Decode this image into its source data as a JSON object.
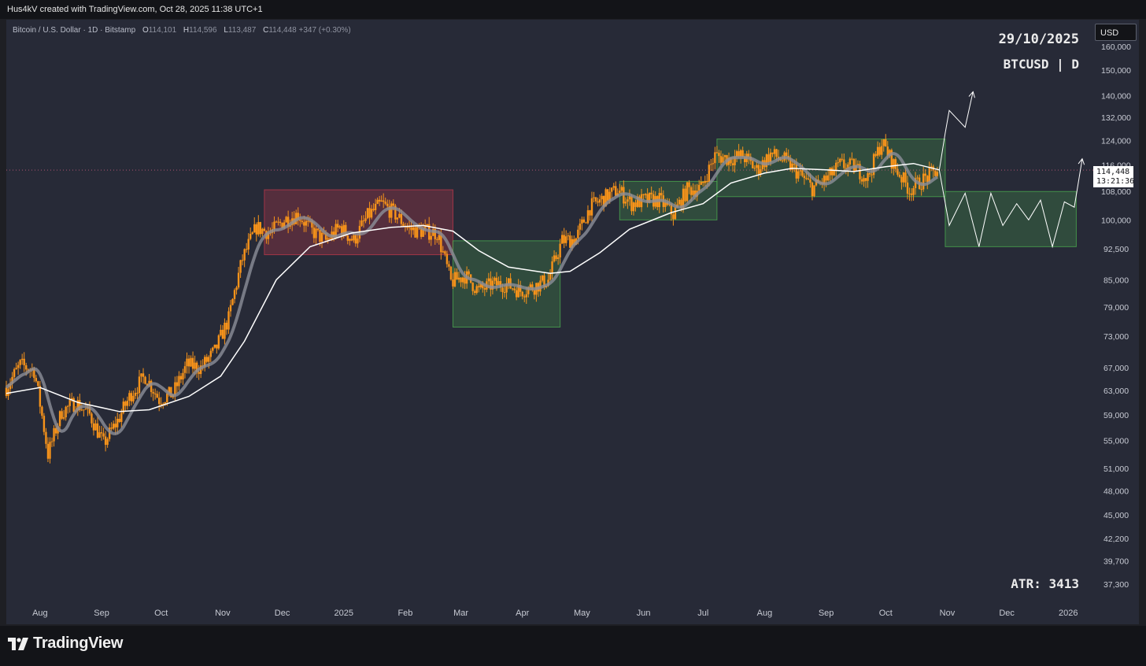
{
  "header": {
    "attribution": "Hus4kV created with TradingView.com, Oct 28, 2025 11:38 UTC+1"
  },
  "legend": {
    "symbol": "Bitcoin / U.S. Dollar · 1D · Bitstamp",
    "open_label": "O",
    "open": "114,101",
    "high_label": "H",
    "high": "114,596",
    "low_label": "L",
    "low": "113,487",
    "close_label": "C",
    "close": "114,448",
    "change": "+347 (+0.30%)"
  },
  "watermark": {
    "date": "29/10/2025",
    "symbol": "BTCUSD | D"
  },
  "indicator": {
    "atr": "ATR: 3413"
  },
  "price_scale": {
    "currency": "USD",
    "last_price": "114,448",
    "countdown": "13:21:36"
  },
  "footer": {
    "brand": "TradingView"
  },
  "colors": {
    "background": "#272a37",
    "candle": "#f7931a",
    "ma_fast": "#8c8f99",
    "ma_slow": "#ffffff",
    "range_red": "#c0394b",
    "range_green": "#4caf50",
    "projection": "#ffffff"
  },
  "chart_data": {
    "type": "line",
    "scale": "log",
    "ylim": [
      35500,
      172000
    ],
    "xlim": [
      "2024-07-15",
      "2026-01-10"
    ],
    "y_ticks": [
      160000,
      150000,
      140000,
      132000,
      124000,
      116000,
      108000,
      100000,
      92500,
      85000,
      79000,
      73000,
      67000,
      63000,
      59000,
      55000,
      51000,
      48000,
      45000,
      42200,
      39700,
      37300
    ],
    "y_tick_labels": [
      "160,000",
      "150,000",
      "140,000",
      "132,000",
      "124,000",
      "116,000",
      "108,000",
      "100,000",
      "92,500",
      "85,000",
      "79,000",
      "73,000",
      "67,000",
      "63,000",
      "59,000",
      "55,000",
      "51,000",
      "48,000",
      "45,000",
      "42,200",
      "39,700",
      "37,300"
    ],
    "x_ticks": [
      {
        "label": "Aug",
        "date": "2024-08-01"
      },
      {
        "label": "Sep",
        "date": "2024-09-01"
      },
      {
        "label": "Oct",
        "date": "2024-10-01"
      },
      {
        "label": "Nov",
        "date": "2024-11-01"
      },
      {
        "label": "Dec",
        "date": "2024-12-01"
      },
      {
        "label": "2025",
        "date": "2025-01-01"
      },
      {
        "label": "Feb",
        "date": "2025-02-01"
      },
      {
        "label": "Mar",
        "date": "2025-03-01"
      },
      {
        "label": "Apr",
        "date": "2025-04-01"
      },
      {
        "label": "May",
        "date": "2025-05-01"
      },
      {
        "label": "Jun",
        "date": "2025-06-01"
      },
      {
        "label": "Jul",
        "date": "2025-07-01"
      },
      {
        "label": "Aug",
        "date": "2025-08-01"
      },
      {
        "label": "Sep",
        "date": "2025-09-01"
      },
      {
        "label": "Oct",
        "date": "2025-10-01"
      },
      {
        "label": "Nov",
        "date": "2025-11-01"
      },
      {
        "label": "Dec",
        "date": "2025-12-01"
      },
      {
        "label": "2026",
        "date": "2026-01-01"
      }
    ],
    "last_price": 114448,
    "series": [
      {
        "name": "BTCUSD close",
        "style": "candles",
        "points": [
          [
            "2024-07-15",
            63500
          ],
          [
            "2024-07-22",
            67500
          ],
          [
            "2024-07-29",
            66500
          ],
          [
            "2024-08-05",
            53000
          ],
          [
            "2024-08-12",
            59500
          ],
          [
            "2024-08-19",
            61000
          ],
          [
            "2024-08-26",
            59000
          ],
          [
            "2024-09-02",
            54500
          ],
          [
            "2024-09-09",
            58000
          ],
          [
            "2024-09-16",
            62500
          ],
          [
            "2024-09-23",
            65500
          ],
          [
            "2024-09-30",
            61500
          ],
          [
            "2024-10-07",
            62500
          ],
          [
            "2024-10-14",
            67500
          ],
          [
            "2024-10-21",
            67000
          ],
          [
            "2024-10-28",
            70000
          ],
          [
            "2024-11-04",
            76500
          ],
          [
            "2024-11-11",
            90000
          ],
          [
            "2024-11-18",
            98000
          ],
          [
            "2024-11-25",
            96500
          ],
          [
            "2024-12-02",
            100000
          ],
          [
            "2024-12-09",
            101500
          ],
          [
            "2024-12-16",
            97000
          ],
          [
            "2024-12-23",
            94500
          ],
          [
            "2024-12-30",
            98000
          ],
          [
            "2025-01-06",
            94500
          ],
          [
            "2025-01-13",
            101000
          ],
          [
            "2025-01-20",
            104500
          ],
          [
            "2025-01-27",
            101500
          ],
          [
            "2025-02-03",
            97500
          ],
          [
            "2025-02-10",
            97000
          ],
          [
            "2025-02-17",
            96500
          ],
          [
            "2025-02-24",
            84500
          ],
          [
            "2025-03-03",
            86000
          ],
          [
            "2025-03-10",
            82500
          ],
          [
            "2025-03-17",
            84000
          ],
          [
            "2025-03-24",
            84000
          ],
          [
            "2025-03-31",
            82500
          ],
          [
            "2025-04-07",
            83500
          ],
          [
            "2025-04-14",
            85000
          ],
          [
            "2025-04-21",
            94500
          ],
          [
            "2025-04-28",
            95000
          ],
          [
            "2025-05-05",
            103500
          ],
          [
            "2025-05-12",
            106000
          ],
          [
            "2025-05-19",
            108500
          ],
          [
            "2025-05-26",
            104500
          ],
          [
            "2025-06-02",
            105500
          ],
          [
            "2025-06-09",
            105500
          ],
          [
            "2025-06-16",
            101500
          ],
          [
            "2025-06-23",
            108500
          ],
          [
            "2025-06-30",
            109000
          ],
          [
            "2025-07-07",
            119000
          ],
          [
            "2025-07-14",
            118000
          ],
          [
            "2025-07-21",
            119000
          ],
          [
            "2025-07-28",
            114500
          ],
          [
            "2025-08-04",
            119500
          ],
          [
            "2025-08-11",
            117500
          ],
          [
            "2025-08-18",
            113500
          ],
          [
            "2025-08-25",
            109000
          ],
          [
            "2025-09-01",
            111500
          ],
          [
            "2025-09-08",
            116000
          ],
          [
            "2025-09-15",
            115500
          ],
          [
            "2025-09-22",
            112000
          ],
          [
            "2025-09-29",
            123500
          ],
          [
            "2025-10-06",
            115000
          ],
          [
            "2025-10-13",
            108500
          ],
          [
            "2025-10-20",
            111500
          ],
          [
            "2025-10-27",
            114448
          ]
        ]
      },
      {
        "name": "Moving average (slow)",
        "style": "line",
        "points": [
          [
            "2024-07-15",
            62500
          ],
          [
            "2024-08-01",
            63500
          ],
          [
            "2024-08-20",
            61000
          ],
          [
            "2024-09-10",
            59500
          ],
          [
            "2024-09-25",
            59800
          ],
          [
            "2024-10-15",
            62000
          ],
          [
            "2024-10-31",
            65500
          ],
          [
            "2024-11-12",
            72000
          ],
          [
            "2024-11-28",
            85000
          ],
          [
            "2024-12-15",
            93000
          ],
          [
            "2025-01-05",
            96500
          ],
          [
            "2025-01-25",
            98000
          ],
          [
            "2025-02-10",
            98500
          ],
          [
            "2025-02-25",
            97000
          ],
          [
            "2025-03-10",
            92000
          ],
          [
            "2025-03-25",
            88000
          ],
          [
            "2025-04-15",
            86500
          ],
          [
            "2025-04-25",
            87000
          ],
          [
            "2025-05-10",
            91500
          ],
          [
            "2025-05-25",
            97500
          ],
          [
            "2025-06-15",
            102000
          ],
          [
            "2025-07-01",
            104500
          ],
          [
            "2025-07-15",
            110500
          ],
          [
            "2025-08-01",
            113500
          ],
          [
            "2025-08-15",
            115000
          ],
          [
            "2025-09-01",
            114500
          ],
          [
            "2025-09-15",
            114000
          ],
          [
            "2025-10-01",
            115500
          ],
          [
            "2025-10-15",
            116500
          ],
          [
            "2025-10-28",
            114500
          ]
        ]
      },
      {
        "name": "Projection up",
        "style": "projection",
        "points": [
          [
            "2025-10-28",
            114448
          ],
          [
            "2025-10-31",
            126500
          ],
          [
            "2025-11-02",
            134500
          ],
          [
            "2025-11-10",
            128500
          ],
          [
            "2025-11-14",
            141500
          ]
        ]
      },
      {
        "name": "Projection range",
        "style": "projection",
        "points": [
          [
            "2025-10-28",
            114448
          ],
          [
            "2025-11-02",
            98500
          ],
          [
            "2025-11-10",
            107500
          ],
          [
            "2025-11-17",
            93000
          ],
          [
            "2025-11-23",
            107500
          ],
          [
            "2025-11-29",
            98500
          ],
          [
            "2025-12-06",
            104500
          ],
          [
            "2025-12-12",
            100000
          ],
          [
            "2025-12-18",
            105500
          ],
          [
            "2025-12-24",
            93000
          ],
          [
            "2025-12-30",
            105000
          ],
          [
            "2026-01-04",
            103500
          ],
          [
            "2026-01-08",
            118000
          ]
        ]
      }
    ],
    "boxes": [
      {
        "color": "red",
        "x0": "2024-11-22",
        "x1": "2025-02-25",
        "y0": 91000,
        "y1": 108500
      },
      {
        "color": "green",
        "x0": "2025-02-25",
        "x1": "2025-04-20",
        "y0": 74800,
        "y1": 94500
      },
      {
        "color": "green",
        "x0": "2025-05-20",
        "x1": "2025-07-08",
        "y0": 100000,
        "y1": 111000
      },
      {
        "color": "green",
        "x0": "2025-07-08",
        "x1": "2025-10-31",
        "y0": 106500,
        "y1": 124500
      },
      {
        "color": "green",
        "x0": "2025-10-31",
        "x1": "2026-01-05",
        "y0": 93000,
        "y1": 108000
      }
    ]
  }
}
